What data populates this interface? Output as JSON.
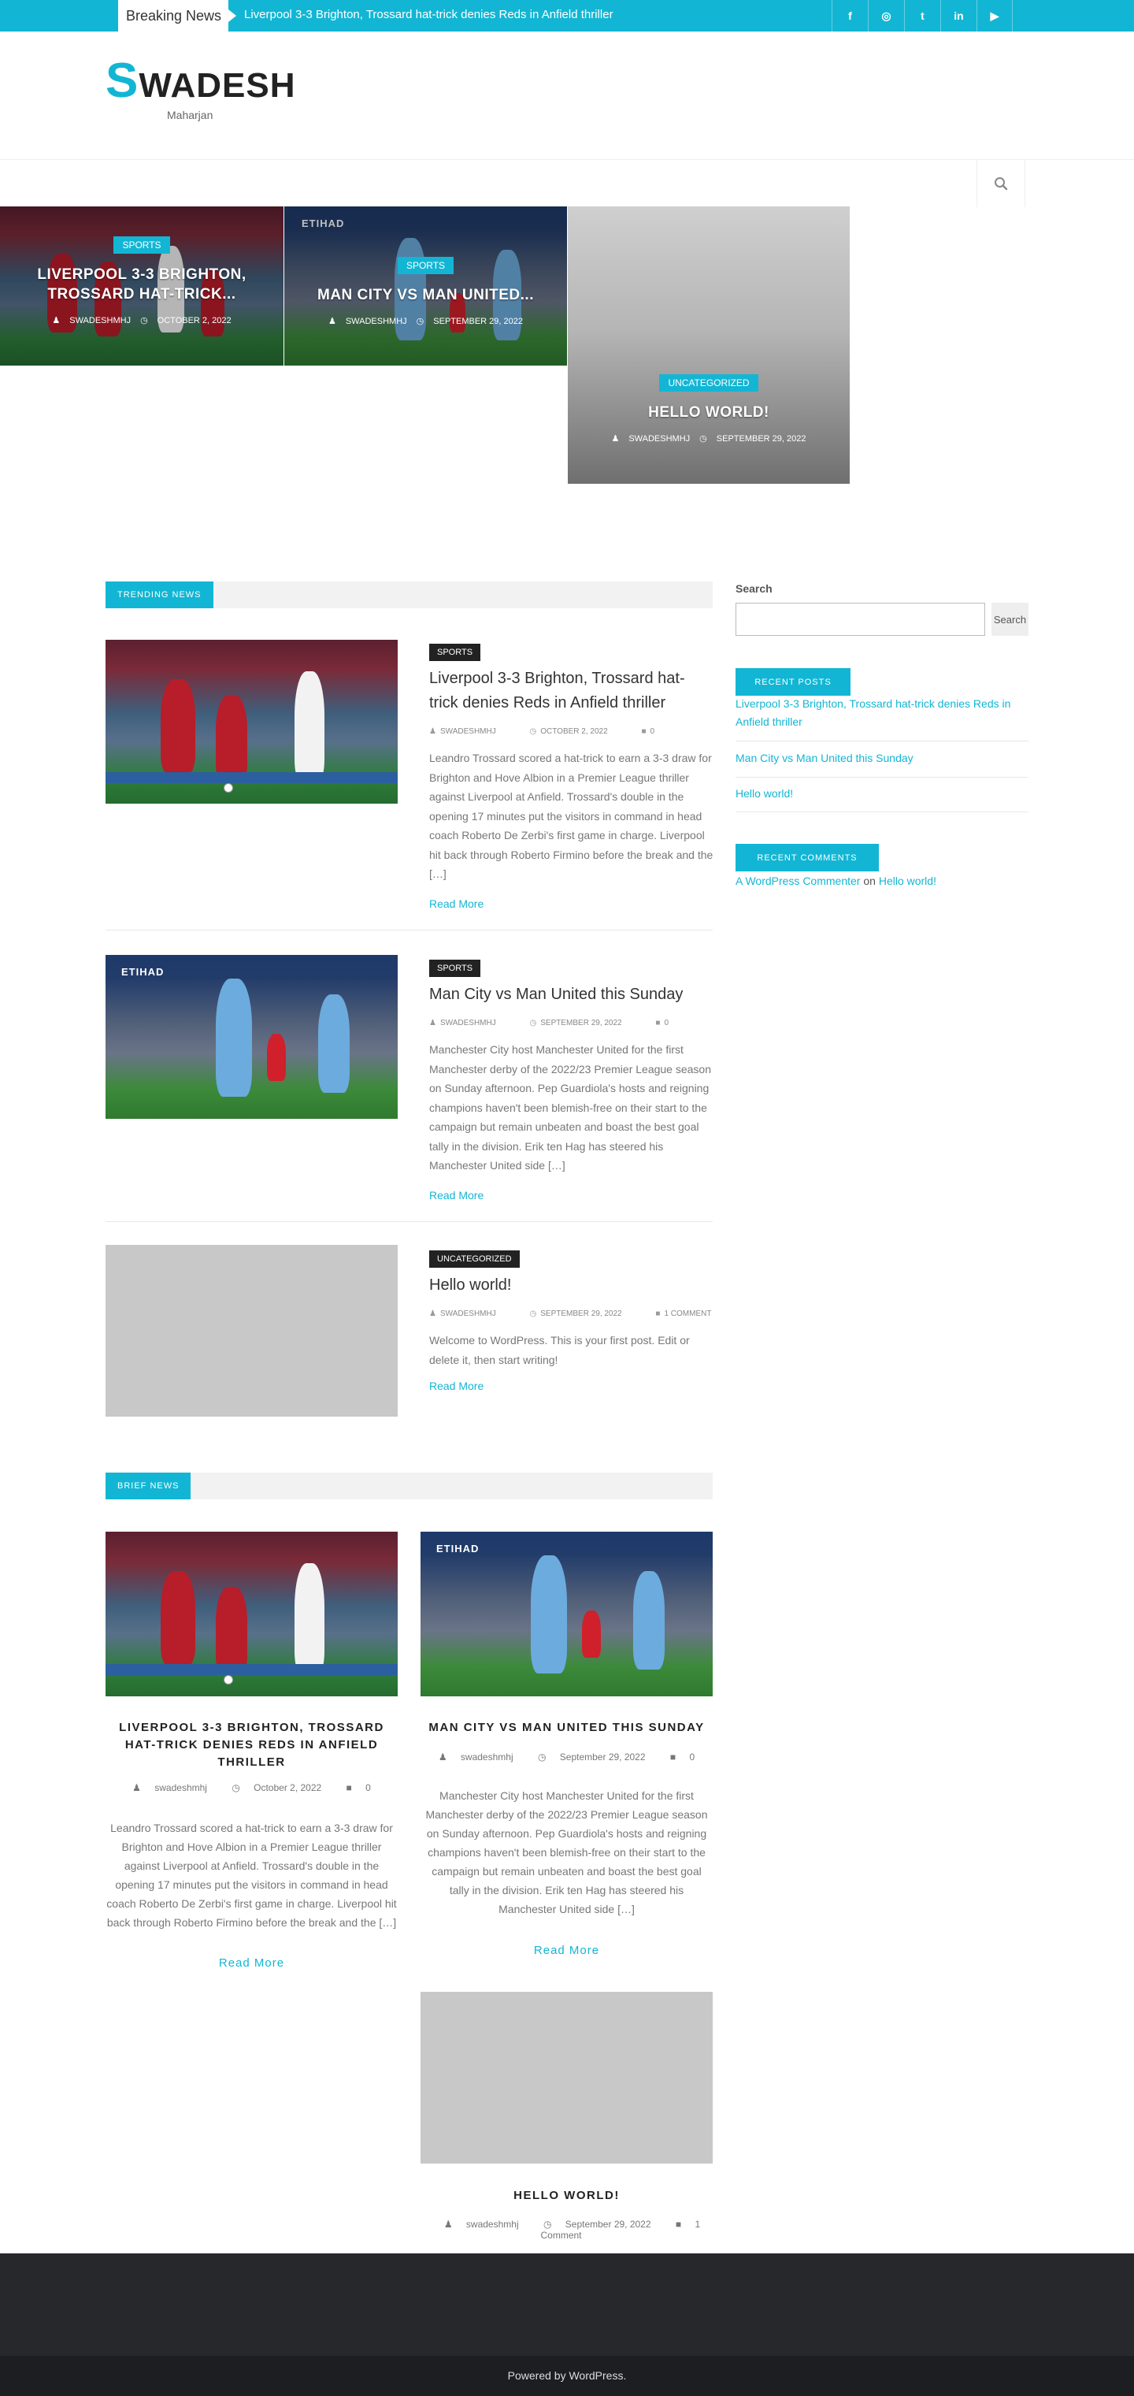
{
  "topbar": {
    "breaking_label": "Breaking News",
    "breaking_text": "Liverpool 3-3 Brighton, Trossard hat-trick denies Reds in Anfield thriller",
    "social": [
      {
        "icon": "facebook-icon",
        "glyph": "f"
      },
      {
        "icon": "instagram-icon",
        "glyph": "◎"
      },
      {
        "icon": "twitter-icon",
        "glyph": "t"
      },
      {
        "icon": "linkedin-icon",
        "glyph": "in"
      },
      {
        "icon": "youtube-icon",
        "glyph": "▶"
      }
    ]
  },
  "header": {
    "logo_first": "S",
    "logo_rest": "WADESH",
    "tagline": "Maharjan"
  },
  "featured": [
    {
      "category": "SPORTS",
      "title_line1": "LIVERPOOL 3-3 BRIGHTON,",
      "title_line2": "TROSSARD HAT-TRICK...",
      "author": "SWADESHMHJ",
      "date": "OCTOBER 2, 2022"
    },
    {
      "category": "SPORTS",
      "title_line1": "MAN CITY VS MAN UNITED...",
      "title_line2": "",
      "author": "SWADESHMHJ",
      "date": "SEPTEMBER 29, 2022"
    },
    {
      "category": "UNCATEGORIZED",
      "title_line1": "HELLO WORLD!",
      "title_line2": "",
      "author": "SWADESHMHJ",
      "date": "SEPTEMBER 29, 2022"
    }
  ],
  "trending": {
    "heading": "TRENDING NEWS",
    "posts": [
      {
        "category": "SPORTS",
        "title": "Liverpool 3-3 Brighton, Trossard hat-trick denies Reds in Anfield thriller",
        "author": "SWADESHMHJ",
        "date": "OCTOBER 2, 2022",
        "comments": "0",
        "excerpt": "Leandro Trossard scored a hat-trick to earn a 3-3 draw for Brighton and Hove Albion in a Premier League thriller against Liverpool at Anfield. Trossard's double in the opening 17 minutes put the visitors in command in head coach Roberto De Zerbi's first game in charge. Liverpool hit back through Roberto Firmino before the break and the […]",
        "read_more": "Read More"
      },
      {
        "category": "SPORTS",
        "title": "Man City vs Man United this Sunday",
        "author": "SWADESHMHJ",
        "date": "SEPTEMBER 29, 2022",
        "comments": "0",
        "excerpt": "Manchester City host Manchester United for the first Manchester derby of the 2022/23 Premier League season on Sunday afternoon. Pep Guardiola's hosts and reigning champions haven't been blemish-free on their start to the campaign but remain unbeaten and boast the best goal tally in the division. Erik ten Hag has steered his Manchester United side […]",
        "read_more": "Read More"
      },
      {
        "category": "UNCATEGORIZED",
        "title": "Hello world!",
        "author": "SWADESHMHJ",
        "date": "SEPTEMBER 29, 2022",
        "comments": "1 COMMENT",
        "excerpt": "Welcome to WordPress. This is your first post. Edit or delete it, then start writing!",
        "read_more": "Read More"
      }
    ]
  },
  "sidebar": {
    "search_label": "Search",
    "search_button": "Search",
    "search_value": "",
    "recent_posts_heading": "RECENT POSTS",
    "recent_posts": [
      "Liverpool 3-3 Brighton, Trossard hat-trick denies Reds in Anfield thriller",
      "Man City vs Man United this Sunday",
      "Hello world!"
    ],
    "recent_comments_heading": "RECENT COMMENTS",
    "comment_author": "A WordPress Commenter",
    "comment_on": "on",
    "comment_post": "Hello world!"
  },
  "brief": {
    "heading": "BRIEF NEWS",
    "posts": [
      {
        "title": "LIVERPOOL 3-3 BRIGHTON, TROSSARD HAT-TRICK DENIES REDS IN ANFIELD THRILLER",
        "author": "swadeshmhj",
        "date": "October 2, 2022",
        "comments": "0",
        "excerpt": "Leandro Trossard scored a hat-trick to earn a 3-3 draw for Brighton and Hove Albion in a Premier League thriller against Liverpool at Anfield. Trossard's double in the opening 17 minutes put the visitors in command in head coach Roberto De Zerbi's first game in charge. Liverpool hit back through Roberto Firmino before the break and the […]",
        "read_more": "Read More"
      },
      {
        "title": "MAN CITY VS MAN UNITED THIS SUNDAY",
        "author": "swadeshmhj",
        "date": "September 29, 2022",
        "comments": "0",
        "excerpt": "Manchester City host Manchester United for the first Manchester derby of the 2022/23 Premier League season on Sunday afternoon. Pep Guardiola's hosts and reigning champions haven't been blemish-free on their start to the campaign but remain unbeaten and boast the best goal tally in the division. Erik ten Hag has steered his Manchester United side […]",
        "read_more": "Read More"
      },
      {
        "title": "HELLO WORLD!",
        "author": "swadeshmhj",
        "date": "September 29, 2022",
        "comments": "1 Comment"
      }
    ]
  },
  "footer": {
    "copyright": "Powered by WordPress."
  },
  "colors": {
    "accent": "#12b6d4",
    "dark": "#222222",
    "footer": "#27282c",
    "footer_bottom": "#1d1e21"
  }
}
